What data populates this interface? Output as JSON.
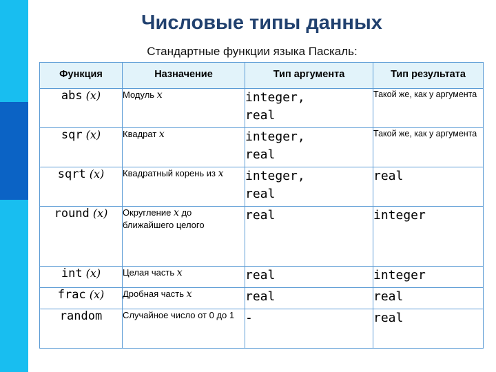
{
  "slide": {
    "title": "Числовые типы данных",
    "subtitle": "Стандартные функции языка Паскаль:",
    "title_color": "#21416F",
    "accent_color": "#18BEF0",
    "accent_dark_color": "#0B63C5",
    "table_border_color": "#5B9BD5",
    "header_bg_color": "#E2F3FA"
  },
  "table": {
    "headers": [
      "Функция",
      "Назначение",
      "Тип аргумента",
      "Тип результата"
    ],
    "rows": [
      {
        "func_name": "abs",
        "func_arg": "(x)",
        "purpose_pre": "Модуль ",
        "purpose_var": "x",
        "purpose_post": "",
        "arg_type": "integer,\nreal",
        "result_type": "Такой же, как у аргумента"
      },
      {
        "func_name": "sqr",
        "func_arg": "(x)",
        "purpose_pre": "Квадрат ",
        "purpose_var": "x",
        "purpose_post": "",
        "arg_type": "integer,\nreal",
        "result_type": "Такой же, как у аргумента"
      },
      {
        "func_name": "sqrt",
        "func_arg": "(x)",
        "purpose_pre": "Квадратный корень из ",
        "purpose_var": "x",
        "purpose_post": "",
        "arg_type": "integer,\nreal",
        "result_type": "real"
      },
      {
        "func_name": "round",
        "func_arg": "(x)",
        "purpose_pre": "Округление ",
        "purpose_var": "x",
        "purpose_post": " до ближайшего целого",
        "arg_type": "real",
        "result_type": "integer"
      },
      {
        "func_name": "int",
        "func_arg": "(x)",
        "purpose_pre": "Целая часть ",
        "purpose_var": "x",
        "purpose_post": "",
        "arg_type": "real",
        "result_type": "integer"
      },
      {
        "func_name": "frac",
        "func_arg": "(x)",
        "purpose_pre": "Дробная часть ",
        "purpose_var": "x",
        "purpose_post": "",
        "arg_type": "real",
        "result_type": "real"
      },
      {
        "func_name": "random",
        "func_arg": "",
        "purpose_pre": "Случайное число от 0 до 1",
        "purpose_var": "",
        "purpose_post": "",
        "arg_type": "-",
        "result_type": "real"
      }
    ]
  }
}
